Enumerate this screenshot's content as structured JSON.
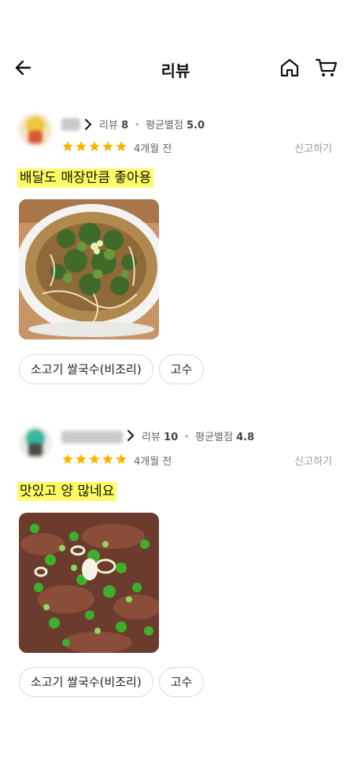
{
  "header": {
    "title": "리뷰",
    "back_icon": "arrow-left-icon",
    "home_icon": "home-icon",
    "cart_icon": "cart-icon"
  },
  "reviews": [
    {
      "review_label": "리뷰",
      "review_count": "8",
      "rating_label": "평균별점",
      "rating_avg": "5.0",
      "stars": 5,
      "time_ago": "4개월 전",
      "report_label": "신고하기",
      "text": "배달도 매장만큼 좋아용",
      "photo_alt": "pho-bowl-photo",
      "tags": [
        "소고기 쌀국수(비조리)",
        "고수"
      ]
    },
    {
      "review_label": "리뷰",
      "review_count": "10",
      "rating_label": "평균별점",
      "rating_avg": "4.8",
      "stars": 5,
      "time_ago": "4개월 전",
      "report_label": "신고하기",
      "text": "맛있고 양 많네요",
      "photo_alt": "pho-closeup-photo",
      "tags": [
        "소고기 쌀국수(비조리)",
        "고수"
      ]
    }
  ],
  "colors": {
    "star": "#f7b500",
    "highlight": "#fdfc64"
  }
}
